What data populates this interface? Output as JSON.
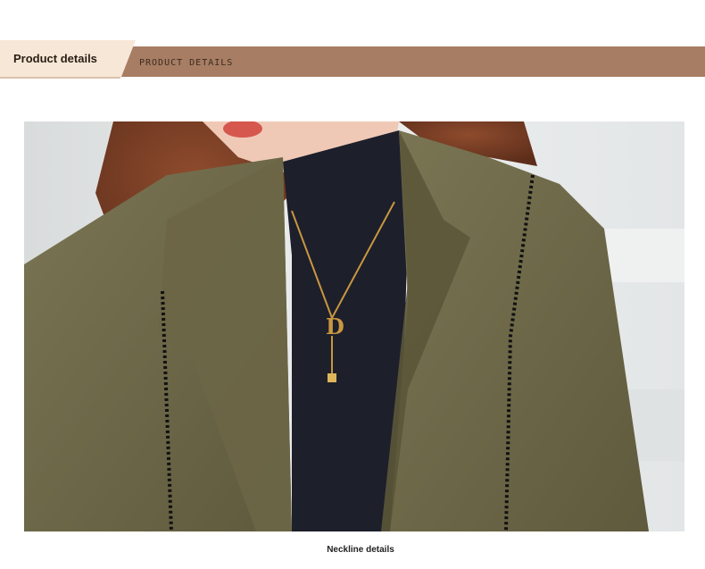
{
  "header": {
    "title": "Product details",
    "subtitle": "PRODUCT DETAILS"
  },
  "photo": {
    "subject": "woman in olive green blazer with beaded trim over black turtleneck, gold D pendant necklace",
    "colors": {
      "blazer": "#6f6a4a",
      "turtleneck": "#1d1f2b",
      "hair": "#7a3f26",
      "gold": "#c9973f",
      "background": "#e7e9ea"
    }
  },
  "caption": "Neckline details",
  "colors": {
    "banner_bar": "#a77d63",
    "banner_tab": "#f6e7d6"
  }
}
